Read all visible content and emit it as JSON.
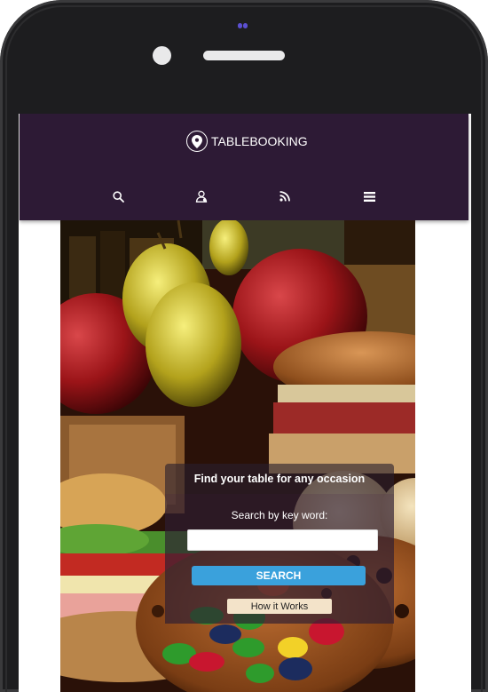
{
  "header": {
    "brand": "TABLEBOOKING"
  },
  "nav": {
    "items": [
      {
        "icon": "search-icon"
      },
      {
        "icon": "user-icon"
      },
      {
        "icon": "rss-icon"
      },
      {
        "icon": "menu-icon"
      }
    ]
  },
  "search": {
    "heading": "Find your table for any occasion",
    "label": "Search by key word:",
    "value": "",
    "button": "SEARCH",
    "how_it_works": "How it Works"
  },
  "colors": {
    "navbar": "#2d1a35",
    "search_button": "#3aa1dc",
    "how_button": "#f3e3c9"
  }
}
